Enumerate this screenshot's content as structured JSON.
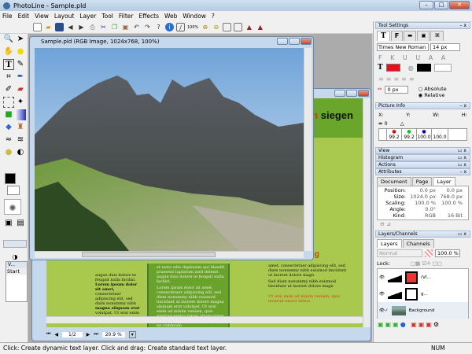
{
  "window": {
    "title": "PhotoLine - Sample.pld",
    "min": "–",
    "max": "□",
    "close": "✕"
  },
  "menu": [
    "File",
    "Edit",
    "View",
    "Layout",
    "Layer",
    "Tool",
    "Filter",
    "Effects",
    "Web",
    "Window",
    "?"
  ],
  "toolbar": {
    "zoom_label": "100%",
    "icons": [
      "new-icon",
      "open-icon",
      "save-icon",
      "back-icon",
      "forward-icon",
      "print-icon",
      "cut-icon",
      "copy-icon",
      "paste-icon",
      "undo-icon",
      "redo-icon",
      "help-icon",
      "info-icon",
      "brush-icon",
      "zoom-in-icon",
      "zoom-out-icon"
    ]
  },
  "front_doc": {
    "title": "Sample.pld  (RGB Image, 1024x768, 100%)"
  },
  "back_doc": {
    "heading_black": "siegen",
    "heading_orange_prefix": "en",
    "subheading": "nladung",
    "col1": [
      "augue duis dolore te feugait nulla facilisi.",
      "Lorem ipsum dolor sit amet,",
      "consectetuer adipiscing elit, sed diam nonummy nibh",
      "magna aliquam erat",
      "volutpat. Ut wisi enim ad minim veniam, quis"
    ],
    "col2": [
      "et iusto odio dignissim qui blandit praesent luptatum zzril delenit augue duis dolore te feugait nulla facilisi.",
      "Lorem ipsum dolor sit amet, consectetuer adipiscing elit, sed diam nonummy nibh euismod tincidunt ut laoreet dolore magna aliquam erat volutpat. Ut wisi enim ad minim veniam, quis nostrud exerci tation ullamcorper suscipit lobortis nisl ut aliquip ex ea commodo"
    ],
    "col3": [
      "amet, consectetuer adipiscing elit, sed diam nonummy nibh euismod tincidunt ut laoreet dolore magn",
      "Sed diam nonummy nibh euismod tincidunt ut laoreet dolore magn"
    ],
    "col3_red": "Ut wisi enim ad minim veniam, quis nostrud exerci tation",
    "page": "1/2",
    "zoom": "20.9 %"
  },
  "history": {
    "title": "V...",
    "items": [
      "Start"
    ]
  },
  "tool_settings": {
    "title": "Tool Settings",
    "font": "Times New Roman",
    "size": "14 px",
    "text_color": "#e8101c",
    "outline_color": "#000000",
    "spacing": "0 px",
    "radio_absolute": "Absolute",
    "radio_relative": "Relative",
    "relative_selected": true
  },
  "picture_info": {
    "title": "Picture Info",
    "labels": [
      "X:",
      "Y:",
      "W:",
      "H:"
    ],
    "distance": "0",
    "values": [
      "99.2",
      "99.2",
      "100.0",
      "100.0"
    ]
  },
  "collapsed_panels": [
    "View",
    "Histogram",
    "Actions"
  ],
  "attributes": {
    "title": "Attributes",
    "tabs": [
      "Document",
      "Page",
      "Layer"
    ],
    "active_tab": "Layer",
    "rows": [
      {
        "label": "Position:",
        "v1": "0.0 px",
        "v2": "0.0 px"
      },
      {
        "label": "Size:",
        "v1": "1024.0 px",
        "v2": "768.0 px"
      },
      {
        "label": "Scaling:",
        "v1": "100.0 %",
        "v2": "100.0 %"
      },
      {
        "label": "Angle:",
        "v1": "0.0°",
        "v2": ""
      },
      {
        "label": "Kind:",
        "v1": "RGB",
        "v2": "16 Bit"
      }
    ]
  },
  "layers": {
    "title": "Layers/Channels",
    "tabs": [
      "Layers",
      "Channels"
    ],
    "blend": "Normal",
    "opacity": "100.0 %",
    "lock_label": "Lock:",
    "items": [
      {
        "name": "(VI..."
      },
      {
        "name": "g..."
      },
      {
        "name": "Background"
      }
    ]
  },
  "status": {
    "text": "Click: Create dynamic text layer. Click and drag: Create standard text layer.",
    "num": "NUM"
  }
}
